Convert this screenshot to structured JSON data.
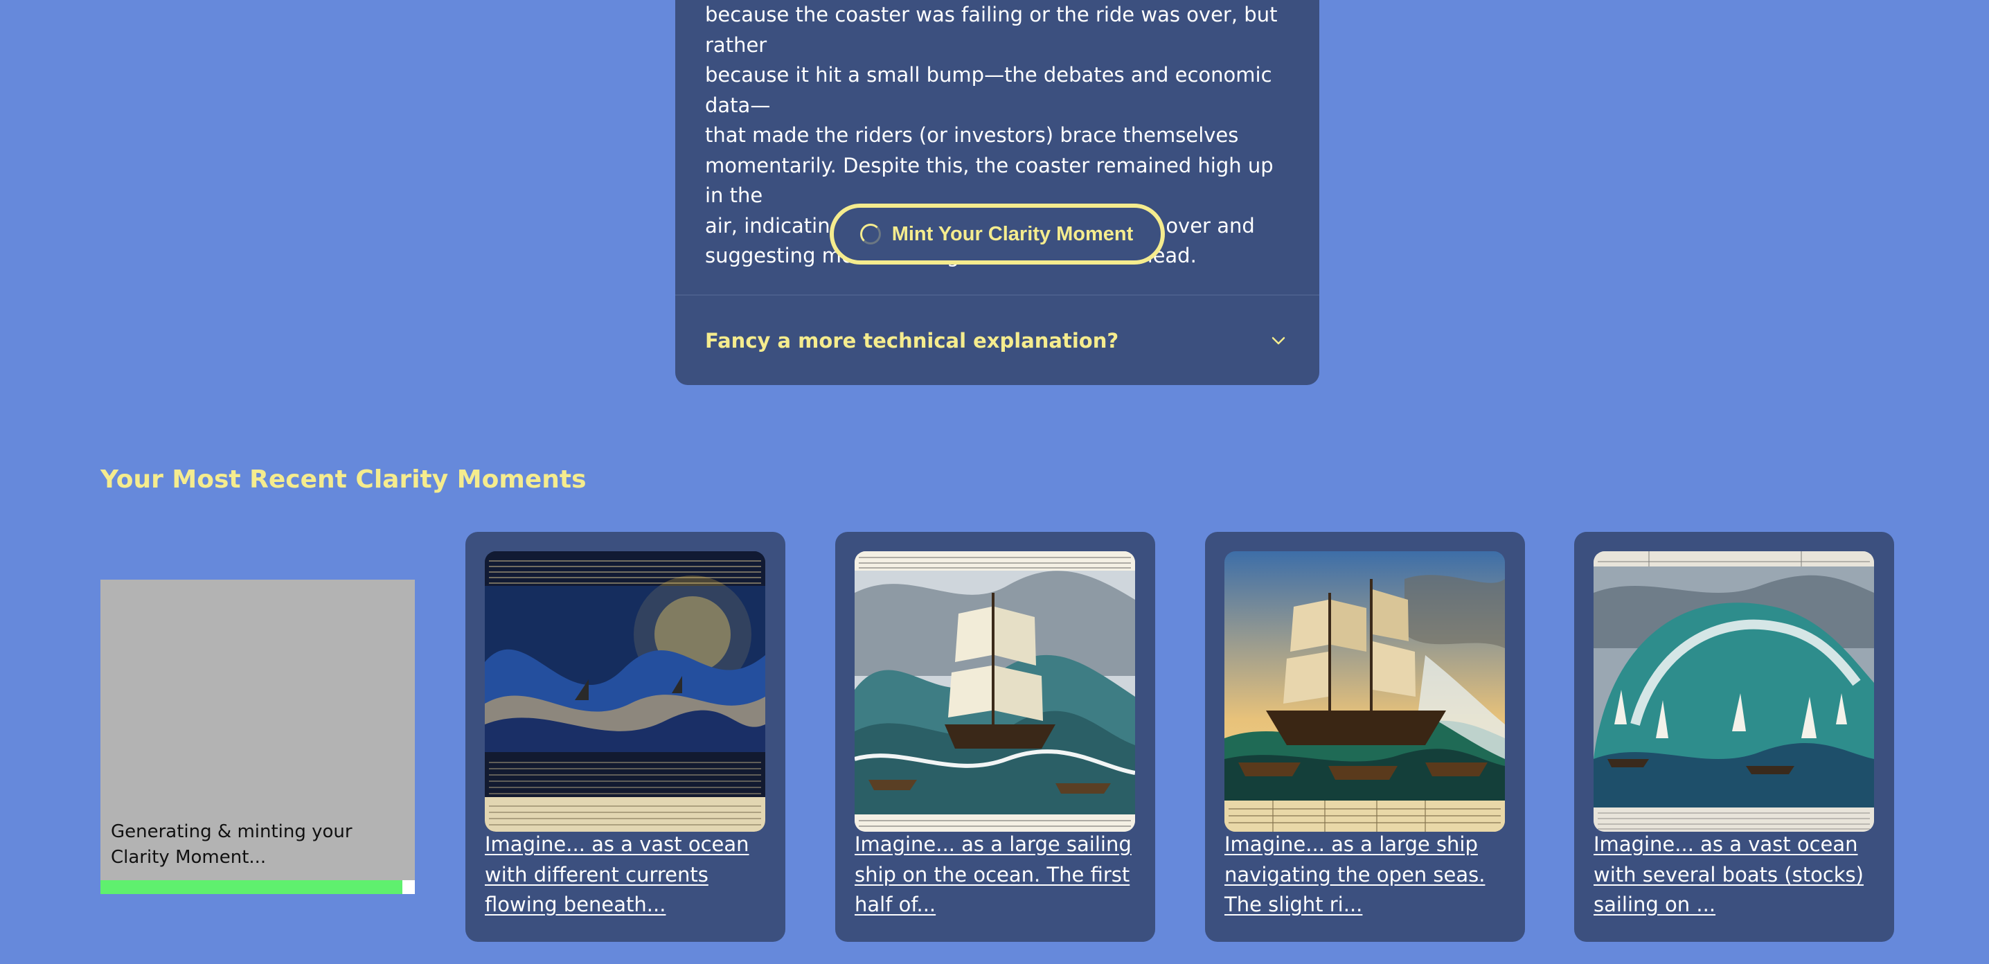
{
  "explanation": {
    "lines": [
      "because the coaster was failing or the ride was over, but rather",
      "because it hit a small bump—the debates and economic data—",
      "that made the riders (or investors) brace themselves",
      "momentarily. Despite this, the coaster remained high up in the",
      "air, indicating that the thrill ride was far from over and",
      "suggesting more exciting climbs could lie ahead."
    ],
    "mint_button_label": "Mint Your Clarity Moment",
    "spinner_icon": "loading-spinner-icon",
    "accordion_label": "Fancy a more technical explanation?",
    "accordion_icon": "chevron-down-icon"
  },
  "recent": {
    "title": "Your Most Recent Clarity Moments",
    "pending": {
      "status_text": "Generating & minting your Clarity Moment...",
      "progress": 0.96
    },
    "moments": [
      {
        "link_text": "Imagine... as a vast ocean with different currents flowing beneath..."
      },
      {
        "link_text": "Imagine... as a large sailing ship on the ocean. The first half of..."
      },
      {
        "link_text": "Imagine... as a large ship navigating the open seas. The slight ri..."
      },
      {
        "link_text": "Imagine... as a vast ocean with several boats (stocks) sailing on ..."
      }
    ]
  },
  "colors": {
    "page_background": "#6689db",
    "card_background": "#3c507f",
    "accent_yellow": "#f5ec8e",
    "progress_green": "#5ff06e",
    "pending_gray": "#b3b3b3"
  }
}
